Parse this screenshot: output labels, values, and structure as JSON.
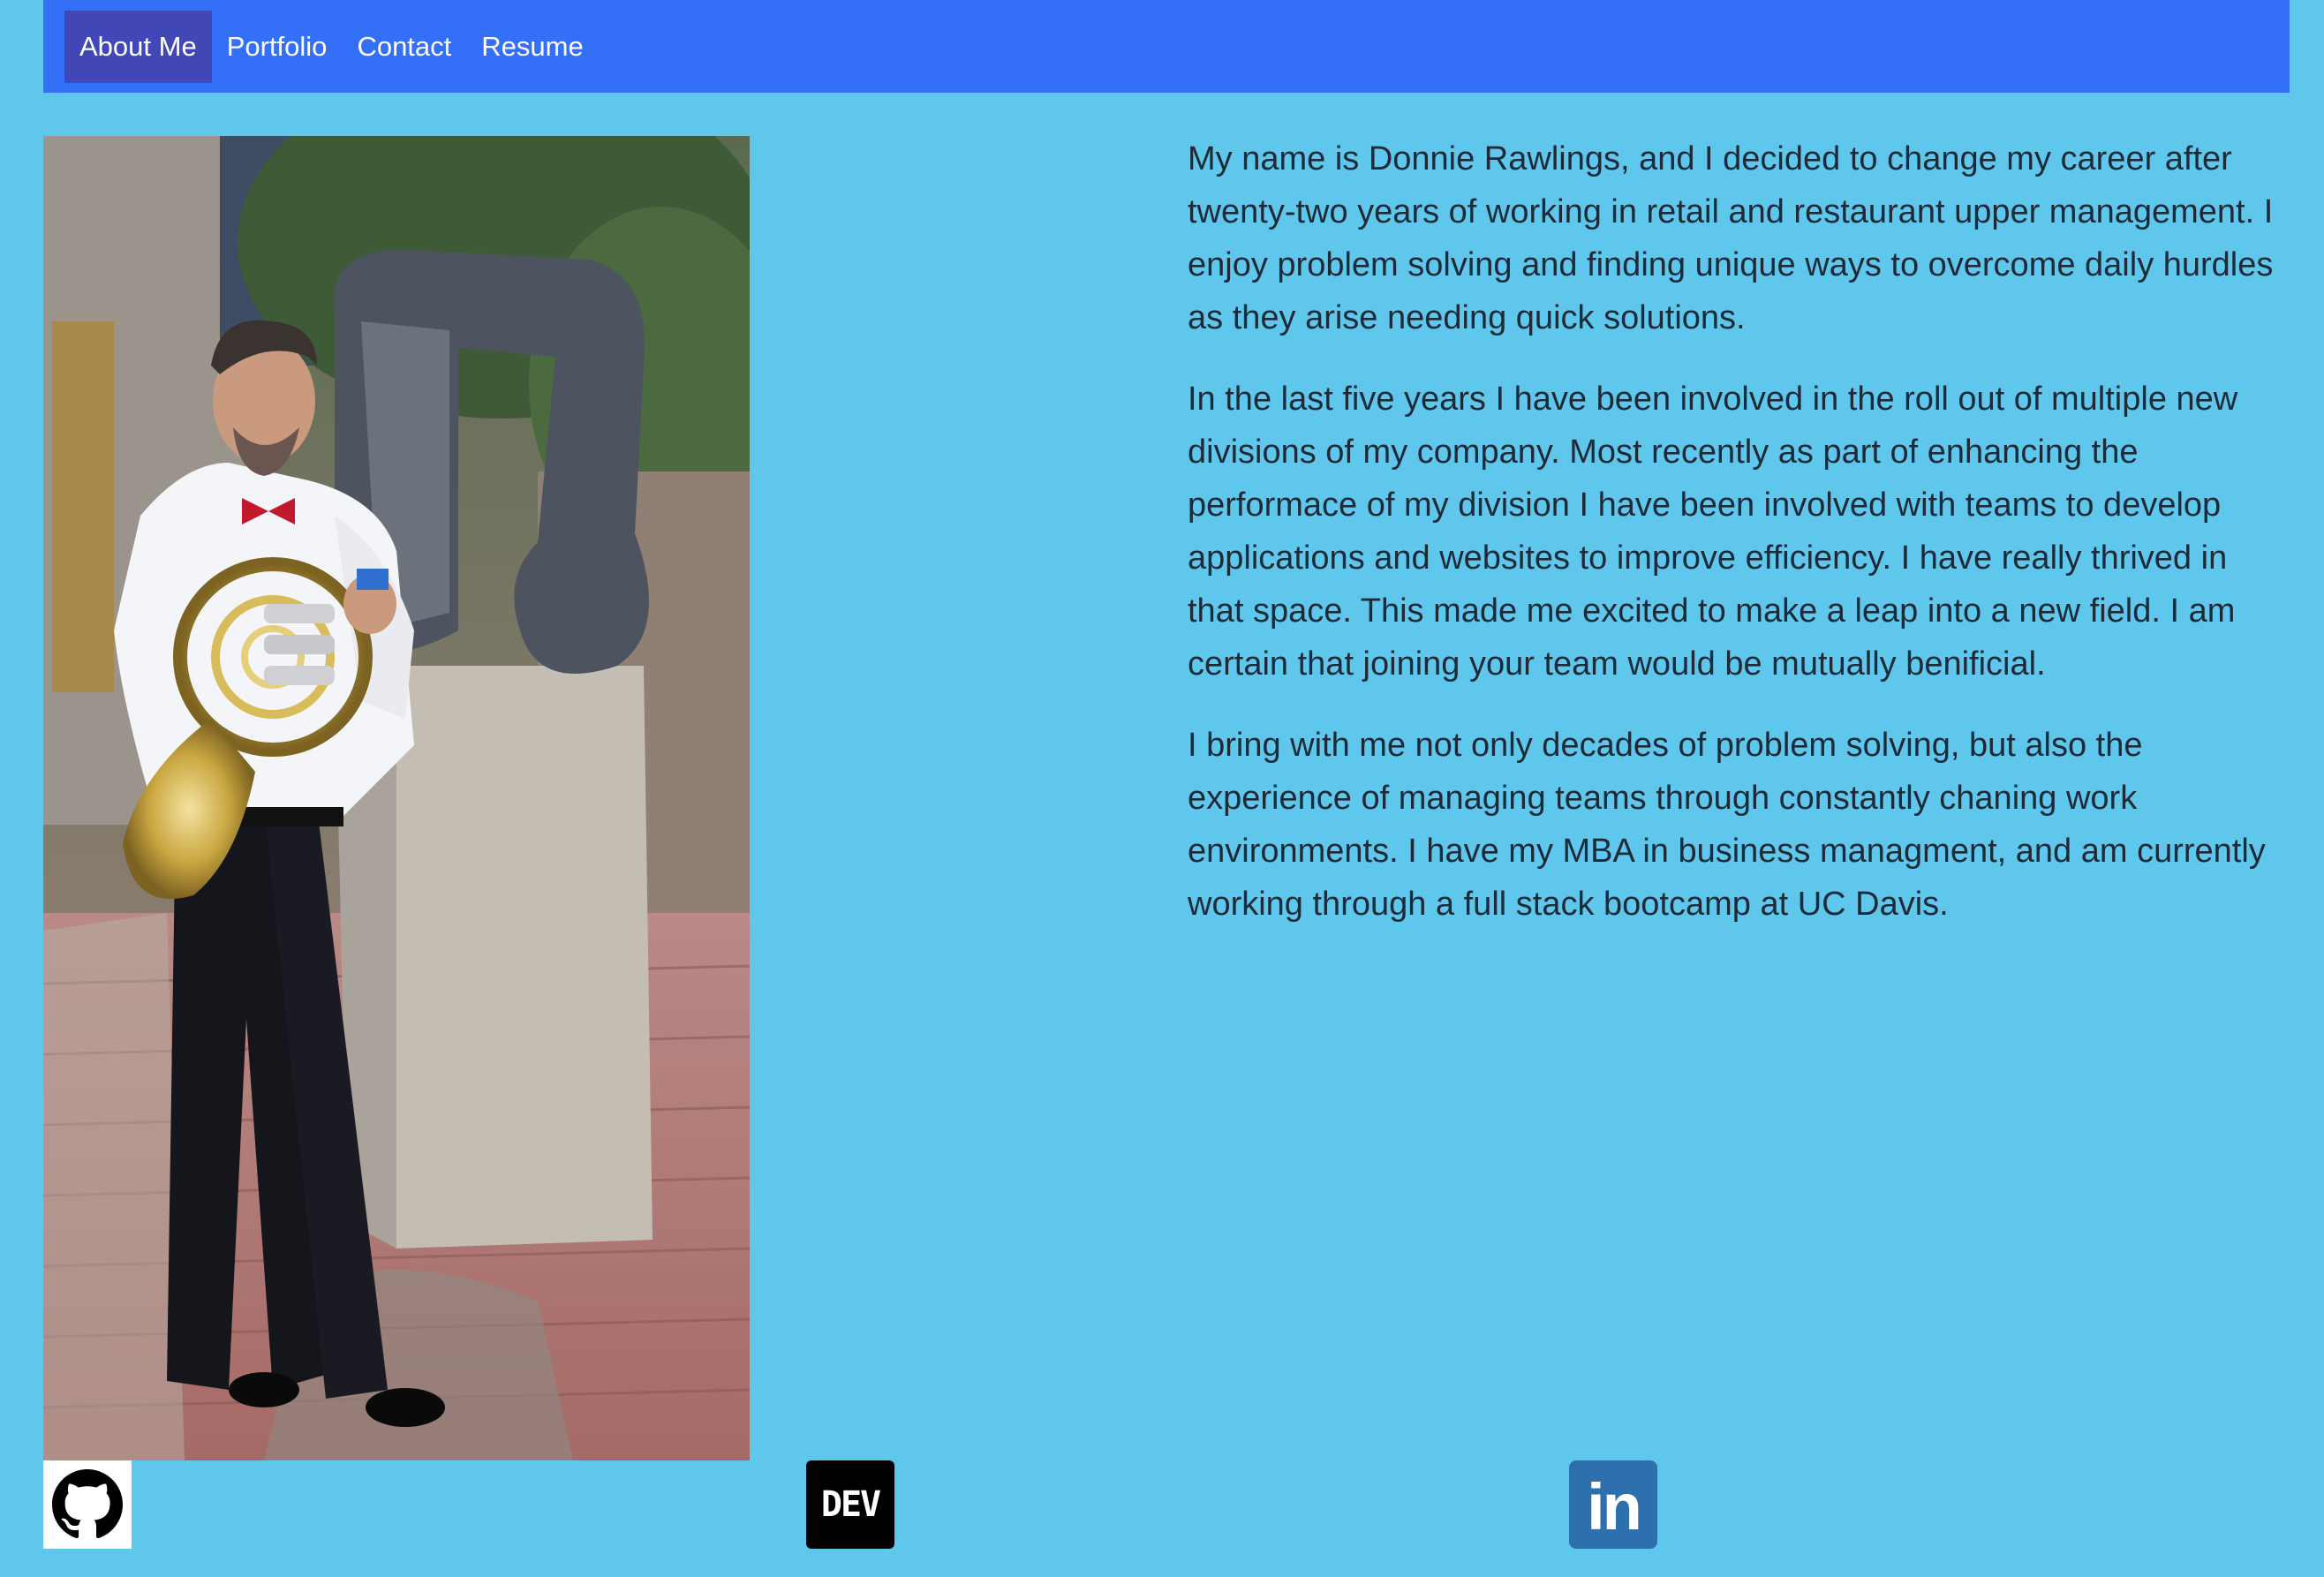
{
  "nav": {
    "items": [
      {
        "label": "About Me",
        "active": true
      },
      {
        "label": "Portfolio",
        "active": false
      },
      {
        "label": "Contact",
        "active": false
      },
      {
        "label": "Resume",
        "active": false
      }
    ]
  },
  "bio": {
    "paragraphs": [
      "My name is Donnie Rawlings, and I decided to change my career after twenty-two years of working in retail and restaurant upper management. I enjoy problem solving and finding unique ways to overcome daily hurdles as they arise needing quick solutions.",
      "In the last five years I have been involved in the roll out of multiple new divisions of my company. Most recently as part of enhancing the performace of my division I have been involved with teams to develop applications and websites to improve efficiency. I have really thrived in that space. This made me excited to make a leap into a new field. I am certain that joining your team would be mutually benificial.",
      "I bring with me not only decades of problem solving, but also the experience of managing teams through constantly chaning work environments. I have my MBA in business managment, and am currently working through a full stack bootcamp at UC Davis."
    ]
  },
  "social": {
    "github_icon": "github-icon",
    "dev_label": "DEV",
    "linkedin_label": "in"
  },
  "colors": {
    "background": "#5fc6ec",
    "navbar": "#346ff8",
    "nav_active": "#4147b6",
    "text": "#1e2a38"
  }
}
